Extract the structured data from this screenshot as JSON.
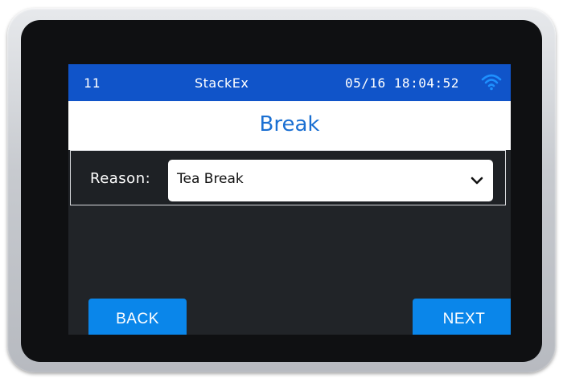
{
  "status_bar": {
    "terminal_id": "11",
    "app_name": "StackEx",
    "datetime": "05/16 18:04:52",
    "wifi_icon": "wifi-icon"
  },
  "page": {
    "title": "Break"
  },
  "form": {
    "reason_label": "Reason:",
    "reason_value": "Tea Break",
    "dropdown_icon": "chevron-down-icon"
  },
  "buttons": {
    "back_label": "BACK",
    "next_label": "NEXT"
  },
  "colors": {
    "status_bar_bg": "#1054c9",
    "title_color": "#1a6fd2",
    "button_bg": "#0a86ea",
    "screen_bg": "#212428"
  }
}
